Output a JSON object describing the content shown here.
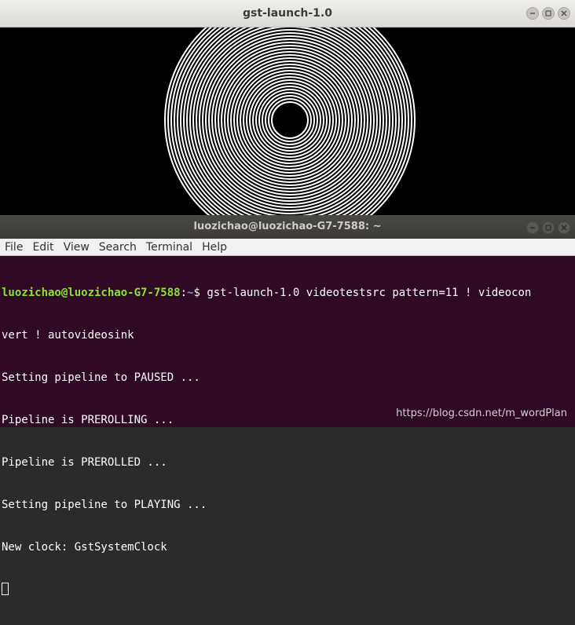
{
  "video_window": {
    "title": "gst-launch-1.0"
  },
  "terminal_window": {
    "title": "luozichao@luozichao-G7-7588: ~",
    "menu": [
      "File",
      "Edit",
      "View",
      "Search",
      "Terminal",
      "Help"
    ],
    "prompt_user": "luozichao@luozichao-G7-7588",
    "prompt_sep": ":",
    "prompt_path": "~",
    "prompt_symbol": "$ ",
    "command_line1": "gst-launch-1.0 videotestsrc pattern=11 ! videocon",
    "command_line2": "vert ! autovideosink",
    "output": [
      "Setting pipeline to PAUSED ...",
      "Pipeline is PREROLLING ...",
      "Pipeline is PREROLLED ...",
      "Setting pipeline to PLAYING ...",
      "New clock: GstSystemClock"
    ]
  },
  "watermark": "https://blog.csdn.net/m_wordPlan",
  "colors": {
    "terminal_bg": "#300a24",
    "prompt_user": "#8ae234",
    "prompt_path": "#729fcf",
    "video_bg": "#000000"
  }
}
